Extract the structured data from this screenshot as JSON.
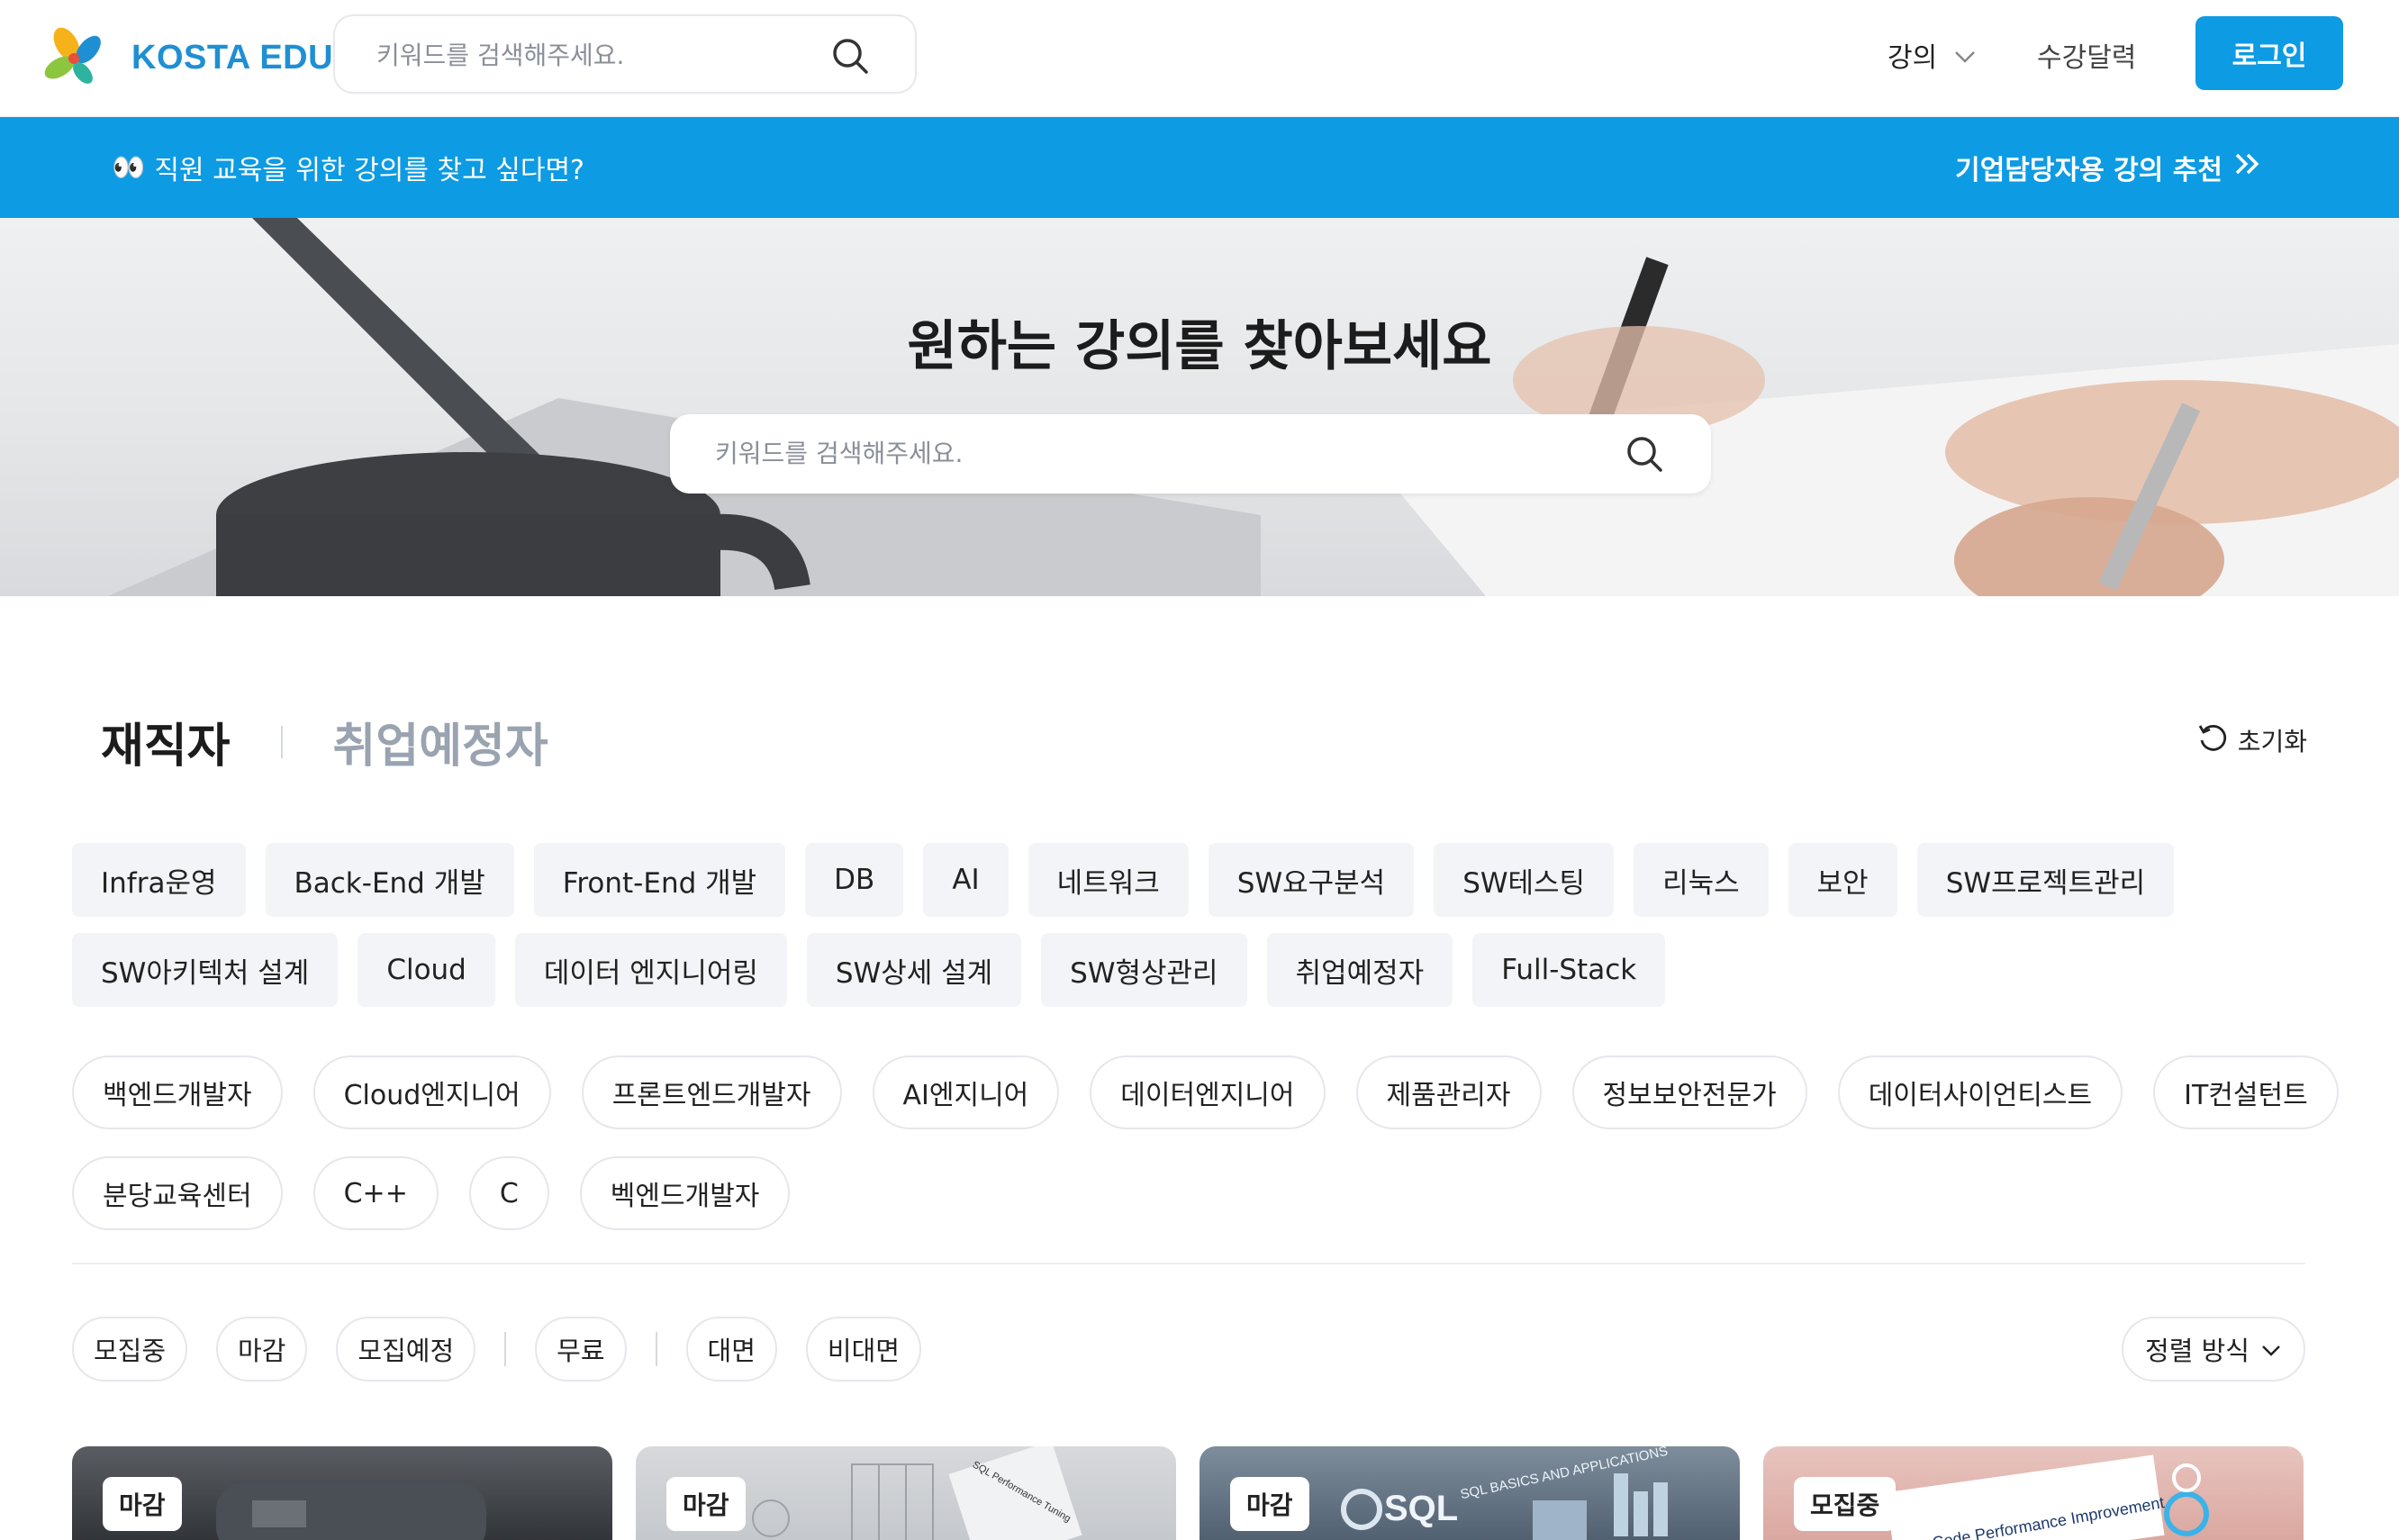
{
  "header": {
    "logo_text": "KOSTA EDU",
    "search_placeholder": "키워드를 검색해주세요.",
    "nav_lecture": "강의",
    "nav_calendar": "수강달력",
    "login_label": "로그인"
  },
  "promo": {
    "left_emoji": "👀",
    "left_text": "직원 교육을 위한 강의를 찾고 싶다면?",
    "right_text": "기업담당자용 강의 추천"
  },
  "hero": {
    "title": "원하는 강의를 찾아보세요",
    "search_placeholder": "키워드를 검색해주세요."
  },
  "tabs": {
    "active": "재직자",
    "inactive": "취업예정자",
    "reset_label": "초기화"
  },
  "categories_row1": [
    "Infra운영",
    "Back-End 개발",
    "Front-End 개발",
    "DB",
    "AI",
    "네트워크",
    "SW요구분석",
    "SW테스팅",
    "리눅스",
    "보안",
    "SW프로젝트관리"
  ],
  "categories_row2": [
    "SW아키텍처 설계",
    "Cloud",
    "데이터 엔지니어링",
    "SW상세 설계",
    "SW형상관리",
    "취업예정자",
    "Full-Stack"
  ],
  "jobs_row1": [
    "백엔드개발자",
    "Cloud엔지니어",
    "프론트엔드개발자",
    "AI엔지니어",
    "데이터엔지니어",
    "제품관리자",
    "정보보안전문가",
    "데이터사이언티스트",
    "IT컨설턴트"
  ],
  "jobs_row2": [
    "분당교육센터",
    "C++",
    "C",
    "벡엔드개발자"
  ],
  "filters": {
    "status": [
      "모집중",
      "마감",
      "모집예정"
    ],
    "price": [
      "무료"
    ],
    "mode": [
      "대면",
      "비대면"
    ],
    "sort_label": "정렬 방식"
  },
  "cards": [
    {
      "badge": "마감",
      "art_label": ""
    },
    {
      "badge": "마감",
      "art_label": "SQL Performance Tuning"
    },
    {
      "badge": "마감",
      "art_label": "SQL BASICS AND APPLICATIONS"
    },
    {
      "badge": "모집중",
      "art_label": "Java Code Performance Improvement"
    }
  ],
  "colors": {
    "brand_blue": "#0d9be3",
    "chip_bg": "#f2f4f7",
    "tab_inactive": "#9aa3b0"
  }
}
